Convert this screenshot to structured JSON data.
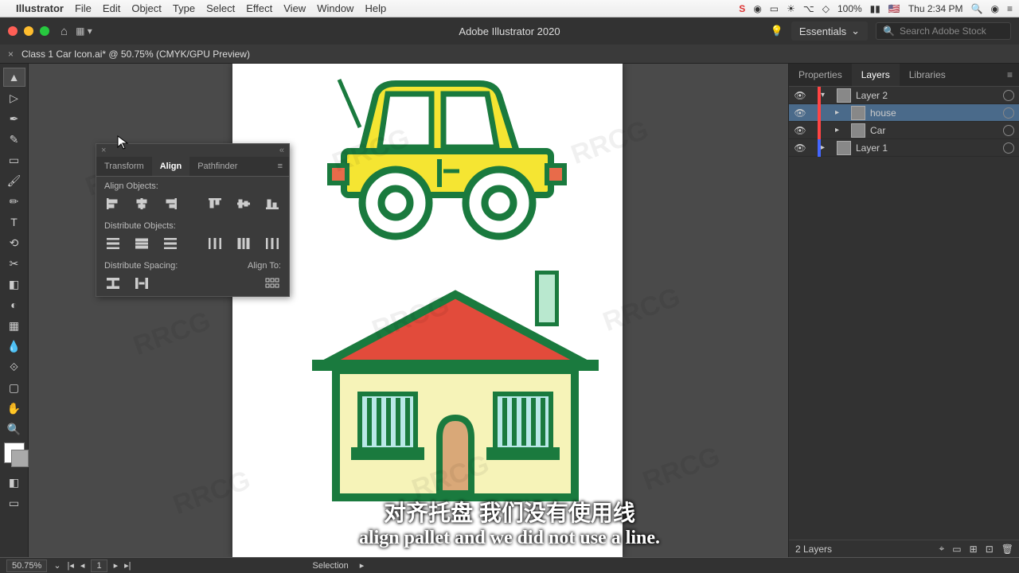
{
  "menubar": {
    "app": "Illustrator",
    "items": [
      "File",
      "Edit",
      "Object",
      "Type",
      "Select",
      "Effect",
      "View",
      "Window",
      "Help"
    ],
    "battery": "100%",
    "clock": "Thu 2:34 PM"
  },
  "titlebar": {
    "title": "Adobe Illustrator 2020",
    "workspace": "Essentials",
    "search_placeholder": "Search Adobe Stock"
  },
  "doc_tab": {
    "label": "Class 1 Car Icon.ai* @ 50.75% (CMYK/GPU Preview)"
  },
  "align_panel": {
    "tabs": [
      "Transform",
      "Align",
      "Pathfinder"
    ],
    "active_tab": "Align",
    "sec1": "Align Objects:",
    "sec2": "Distribute Objects:",
    "sec3": "Distribute Spacing:",
    "sec4": "Align To:"
  },
  "right_panel": {
    "tabs": [
      "Properties",
      "Layers",
      "Libraries"
    ],
    "active_tab": "Layers",
    "layers": [
      {
        "name": "Layer 2",
        "color": "#ff4444",
        "indent": 0,
        "exp": "▾"
      },
      {
        "name": "house",
        "color": "#ff4444",
        "indent": 1,
        "exp": "▸",
        "sel": true
      },
      {
        "name": "Car",
        "color": "#ff4444",
        "indent": 1,
        "exp": "▸"
      },
      {
        "name": "Layer 1",
        "color": "#4466ff",
        "indent": 0,
        "exp": "▸"
      }
    ],
    "footer": "2 Layers"
  },
  "statusbar": {
    "zoom": "50.75%",
    "nav": "1",
    "tool": "Selection"
  },
  "subtitle": {
    "cn": "对齐托盘 我们没有使用线",
    "en": "align pallet and we did not use a line."
  },
  "watermark": "RRCG"
}
